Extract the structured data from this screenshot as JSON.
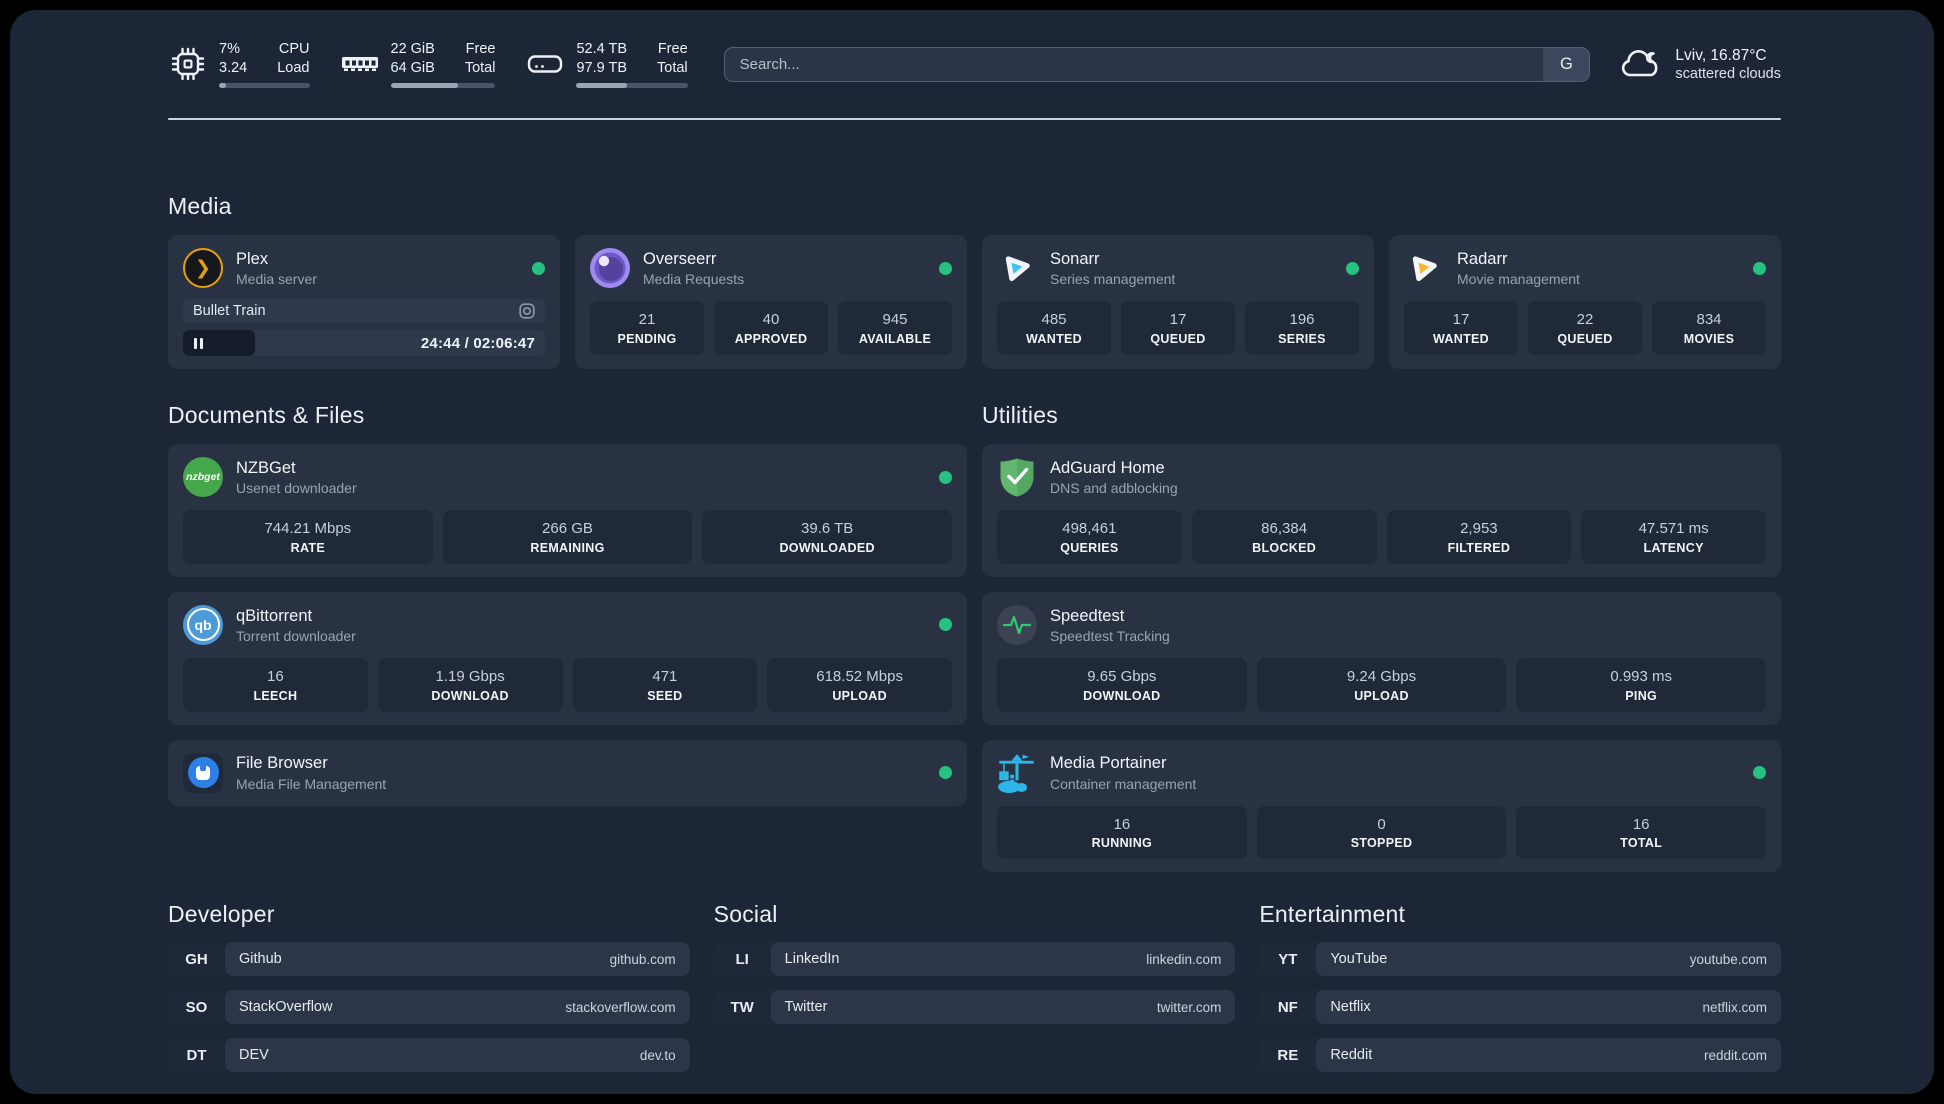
{
  "header": {
    "cpu": {
      "top_value": "7%",
      "bottom_value": "3.24",
      "top_label": "CPU",
      "bottom_label": "Load",
      "progress_pct": 8
    },
    "memory": {
      "top_value": "22 GiB",
      "bottom_value": "64 GiB",
      "top_label": "Free",
      "bottom_label": "Total",
      "progress_pct": 64
    },
    "storage": {
      "top_value": "52.4 TB",
      "bottom_value": "97.9 TB",
      "top_label": "Free",
      "bottom_label": "Total",
      "progress_pct": 45
    },
    "search": {
      "placeholder": "Search...",
      "engine": "G"
    },
    "weather": {
      "location_temp": "Lviv, 16.87°C",
      "condition": "scattered clouds"
    }
  },
  "sections": {
    "media": "Media",
    "documents": "Documents & Files",
    "utilities": "Utilities",
    "developer": "Developer",
    "social": "Social",
    "entertainment": "Entertainment"
  },
  "apps": {
    "plex": {
      "name": "Plex",
      "description": "Media server",
      "now_playing": "Bullet Train",
      "time": "24:44 / 02:06:47",
      "progress_pct": 20
    },
    "overseerr": {
      "name": "Overseerr",
      "description": "Media Requests",
      "stats": [
        {
          "value": "21",
          "label": "PENDING"
        },
        {
          "value": "40",
          "label": "APPROVED"
        },
        {
          "value": "945",
          "label": "AVAILABLE"
        }
      ]
    },
    "sonarr": {
      "name": "Sonarr",
      "description": "Series management",
      "stats": [
        {
          "value": "485",
          "label": "WANTED"
        },
        {
          "value": "17",
          "label": "QUEUED"
        },
        {
          "value": "196",
          "label": "SERIES"
        }
      ]
    },
    "radarr": {
      "name": "Radarr",
      "description": "Movie management",
      "stats": [
        {
          "value": "17",
          "label": "WANTED"
        },
        {
          "value": "22",
          "label": "QUEUED"
        },
        {
          "value": "834",
          "label": "MOVIES"
        }
      ]
    },
    "nzbget": {
      "name": "NZBGet",
      "description": "Usenet downloader",
      "logo_text": "nzbget",
      "stats": [
        {
          "value": "744.21 Mbps",
          "label": "RATE"
        },
        {
          "value": "266 GB",
          "label": "REMAINING"
        },
        {
          "value": "39.6 TB",
          "label": "DOWNLOADED"
        }
      ]
    },
    "qbittorrent": {
      "name": "qBittorrent",
      "description": "Torrent downloader",
      "logo_text": "qb",
      "stats": [
        {
          "value": "16",
          "label": "LEECH"
        },
        {
          "value": "1.19 Gbps",
          "label": "DOWNLOAD"
        },
        {
          "value": "471",
          "label": "SEED"
        },
        {
          "value": "618.52 Mbps",
          "label": "UPLOAD"
        }
      ]
    },
    "filebrowser": {
      "name": "File Browser",
      "description": "Media File Management"
    },
    "adguard": {
      "name": "AdGuard Home",
      "description": "DNS and adblocking",
      "stats": [
        {
          "value": "498,461",
          "label": "QUERIES"
        },
        {
          "value": "86,384",
          "label": "BLOCKED"
        },
        {
          "value": "2,953",
          "label": "FILTERED"
        },
        {
          "value": "47.571 ms",
          "label": "LATENCY"
        }
      ]
    },
    "speedtest": {
      "name": "Speedtest",
      "description": "Speedtest Tracking",
      "stats": [
        {
          "value": "9.65 Gbps",
          "label": "DOWNLOAD"
        },
        {
          "value": "9.24 Gbps",
          "label": "UPLOAD"
        },
        {
          "value": "0.993 ms",
          "label": "PING"
        }
      ]
    },
    "portainer": {
      "name": "Media Portainer",
      "description": "Container management",
      "stats": [
        {
          "value": "16",
          "label": "RUNNING"
        },
        {
          "value": "0",
          "label": "STOPPED"
        },
        {
          "value": "16",
          "label": "TOTAL"
        }
      ]
    }
  },
  "bookmarks": {
    "developer": [
      {
        "abbr": "GH",
        "name": "Github",
        "url": "github.com"
      },
      {
        "abbr": "SO",
        "name": "StackOverflow",
        "url": "stackoverflow.com"
      },
      {
        "abbr": "DT",
        "name": "DEV",
        "url": "dev.to"
      }
    ],
    "social": [
      {
        "abbr": "LI",
        "name": "LinkedIn",
        "url": "linkedin.com"
      },
      {
        "abbr": "TW",
        "name": "Twitter",
        "url": "twitter.com"
      }
    ],
    "entertainment": [
      {
        "abbr": "YT",
        "name": "YouTube",
        "url": "youtube.com"
      },
      {
        "abbr": "NF",
        "name": "Netflix",
        "url": "netflix.com"
      },
      {
        "abbr": "RE",
        "name": "Reddit",
        "url": "reddit.com"
      }
    ]
  },
  "colors": {
    "status_online": "#26c281",
    "plex_accent": "#e5a00d"
  }
}
